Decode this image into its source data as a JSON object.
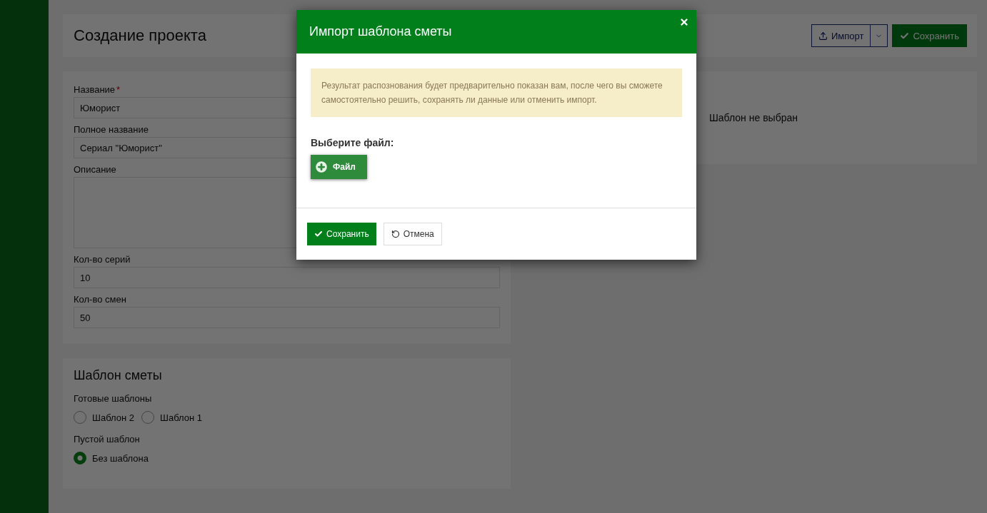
{
  "page": {
    "title": "Создание проекта",
    "actions": [
      {
        "kind": "import",
        "label": "Импорт"
      },
      {
        "kind": "save",
        "label": "Сохранить"
      }
    ]
  },
  "form": {
    "fields": [
      {
        "label": "Название",
        "required_mark": "*",
        "value": "Юморист",
        "kind": "input"
      },
      {
        "label": "Полное название",
        "value": "Сериал \"Юморист\"",
        "kind": "input"
      },
      {
        "label": "Описание",
        "kind": "textarea"
      },
      {
        "label": "Кол-во серий",
        "value": "10",
        "kind": "input"
      },
      {
        "label": "Кол-во смен",
        "value": "50",
        "kind": "input"
      }
    ]
  },
  "preview": {
    "text": "Шаблон не выбран"
  },
  "template": {
    "title": "Шаблон сметы",
    "groups": [
      {
        "label": "Готовые шаблоны",
        "options": [
          {
            "label": "Шаблон 2",
            "selected": false
          },
          {
            "label": "Шаблон 1",
            "selected": false
          }
        ]
      },
      {
        "label": "Пустой шаблон",
        "options": [
          {
            "label": "Без шаблона",
            "selected": true
          }
        ]
      }
    ]
  },
  "modal": {
    "title": "Импорт шаблона сметы",
    "alert": "Результат распознования будет предварительно показан вам, после чего вы сможете самостоятельно решить, сохранять ли данные или отменить импорт.",
    "file_label": "Выберите файл:",
    "file_button": "Файл",
    "buttons": [
      {
        "kind": "save",
        "label": "Сохранить"
      },
      {
        "kind": "cancel",
        "label": "Отмена"
      }
    ]
  }
}
